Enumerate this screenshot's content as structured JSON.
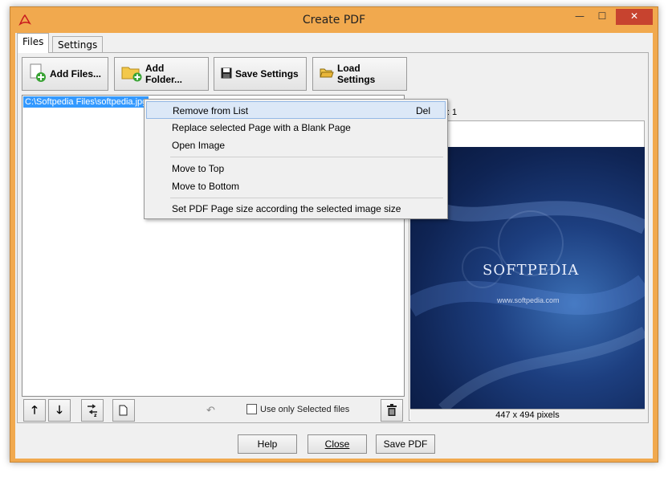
{
  "window": {
    "title": "Create PDF"
  },
  "titlebar_buttons": {
    "minimize": "—",
    "maximize": "☐",
    "close": "✕"
  },
  "tabs": [
    {
      "label": "Files"
    },
    {
      "label": "Settings"
    }
  ],
  "toolbar": {
    "add_files": "Add Files...",
    "add_folder": "Add Folder...",
    "save_settings": "Save Settings",
    "load_settings": "Load Settings"
  },
  "file_list": {
    "items": [
      {
        "path": "C:\\Softpedia Files\\softpedia.jpg"
      }
    ]
  },
  "list_toolbar": {
    "use_only_selected": "Use only Selected files"
  },
  "preview": {
    "page_label": "Page #: 1",
    "size_caption": "447 x 494 pixels",
    "image_logo": "SOFTPEDIA",
    "image_url": "www.softpedia.com"
  },
  "context_menu": {
    "items": [
      {
        "label": "Remove from List",
        "shortcut": "Del"
      },
      {
        "label": "Replace selected Page with a Blank Page"
      },
      {
        "label": "Open Image"
      },
      {
        "label": "Move to Top"
      },
      {
        "label": "Move to Bottom"
      },
      {
        "label": "Set PDF Page size according the selected image size"
      }
    ]
  },
  "bottom_buttons": {
    "help": "Help",
    "close": "Close",
    "save_pdf": "Save PDF"
  },
  "colors": {
    "title_bar": "#f1a94e",
    "selection": "#3399ff",
    "close_button": "#c7432f"
  }
}
